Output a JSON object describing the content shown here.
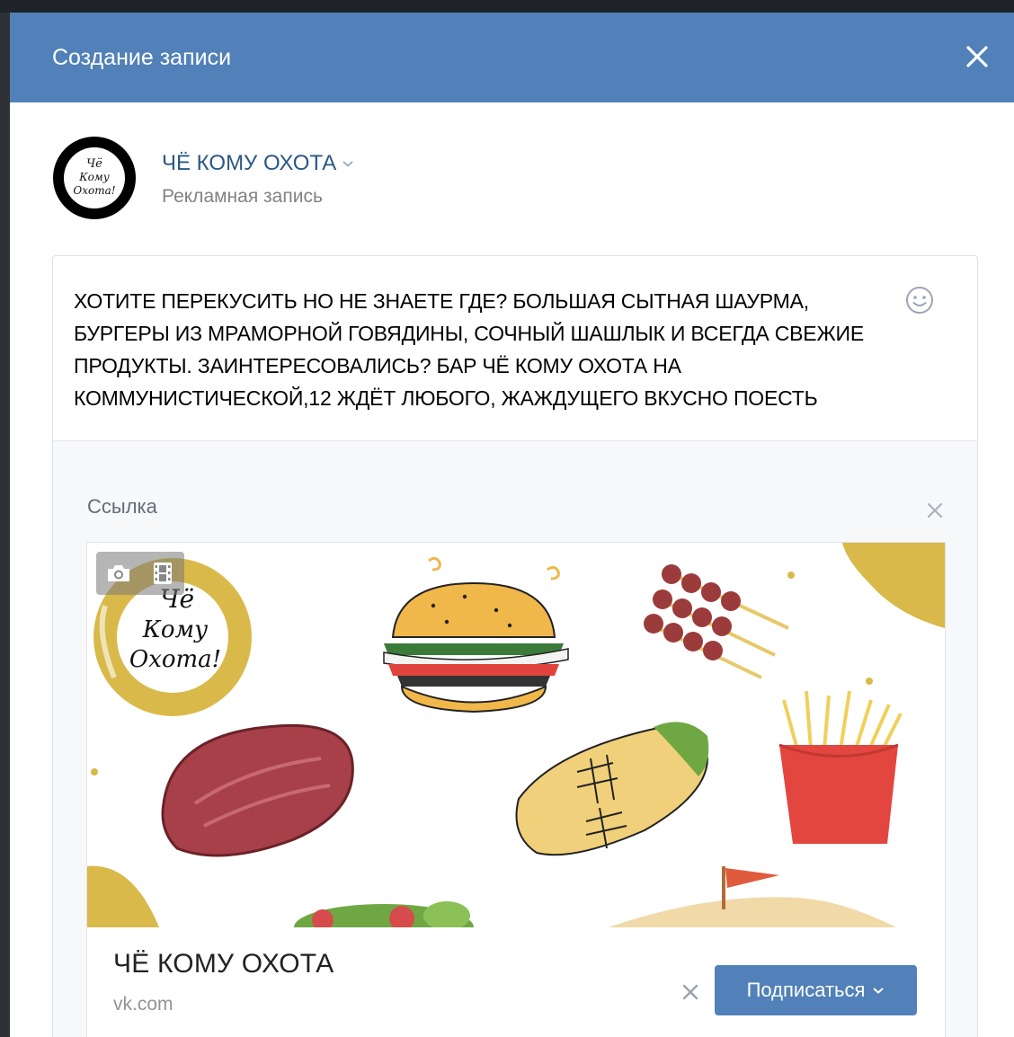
{
  "dialog": {
    "title": "Создание записи"
  },
  "author": {
    "name": "ЧЁ КОМУ ОХОТА",
    "subtitle": "Рекламная запись",
    "logo_text": "Чё Кому Охота!"
  },
  "post": {
    "text": "ХОТИТЕ ПЕРЕКУСИТЬ НО НЕ ЗНАЕТЕ ГДЕ? БОЛЬШАЯ СЫТНАЯ ШАУРМА, БУРГЕРЫ ИЗ МРАМОРНОЙ ГОВЯДИНЫ, СОЧНЫЙ ШАШЛЫК И ВСЕГДА СВЕЖИЕ ПРОДУКТЫ. ЗАИНТЕРЕСОВАЛИСЬ? БАР ЧЁ КОМУ ОХОТА НА КОММУНИСТИЧЕСКОЙ,12 ЖДЁТ ЛЮБОГО, ЖАЖДУЩЕГО ВКУСНО ПОЕСТЬ"
  },
  "link": {
    "label": "Ссылка",
    "title": "ЧЁ КОМУ ОХОТА",
    "domain": "vk.com",
    "button_label": "Подписаться",
    "image_logo_text": "Чё Кому Охота!"
  },
  "colors": {
    "header": "#5181b8",
    "link": "#2a5885",
    "button": "#5181b8",
    "gold": "#d9b94a",
    "meat": "#9c3b3b"
  },
  "icons": {
    "close": "close-icon",
    "dropdown": "chevron-down-icon",
    "emoji": "smile-icon",
    "camera": "camera-icon",
    "film": "film-icon"
  }
}
